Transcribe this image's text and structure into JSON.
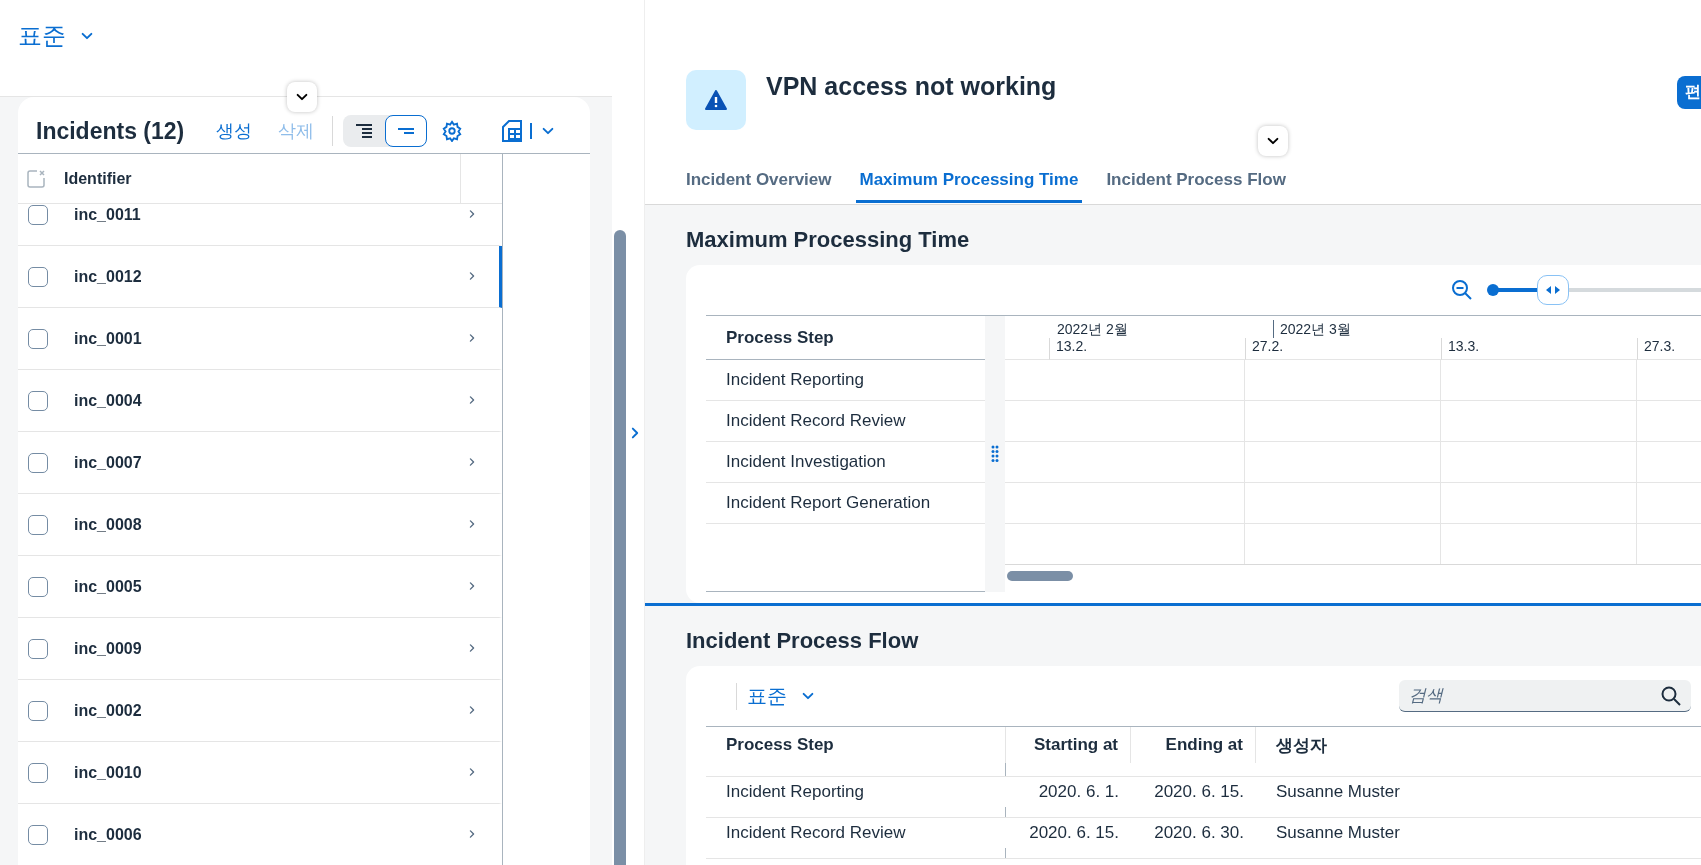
{
  "variant": {
    "label": "표준"
  },
  "list": {
    "title": "Incidents (12)",
    "actions": [
      {
        "label": "생성",
        "disabled": false
      },
      {
        "label": "삭제",
        "disabled": true
      }
    ],
    "view_toggle": [
      {
        "selected": false
      },
      {
        "selected": true
      }
    ],
    "column": "Identifier",
    "rows": [
      {
        "id": "inc_0011",
        "selected": false,
        "checked": false
      },
      {
        "id": "inc_0012",
        "selected": true,
        "checked": false
      },
      {
        "id": "inc_0001",
        "selected": false,
        "checked": false
      },
      {
        "id": "inc_0004",
        "selected": false,
        "checked": false
      },
      {
        "id": "inc_0007",
        "selected": false,
        "checked": false
      },
      {
        "id": "inc_0008",
        "selected": false,
        "checked": false
      },
      {
        "id": "inc_0005",
        "selected": false,
        "checked": false
      },
      {
        "id": "inc_0009",
        "selected": false,
        "checked": false
      },
      {
        "id": "inc_0002",
        "selected": false,
        "checked": false
      },
      {
        "id": "inc_0010",
        "selected": false,
        "checked": false
      },
      {
        "id": "inc_0006",
        "selected": false,
        "checked": false
      }
    ]
  },
  "object": {
    "title": "VPN access not working",
    "edit_button": "편",
    "tabs": [
      {
        "label": "Incident Overview",
        "selected": false
      },
      {
        "label": "Maximum Processing Time",
        "selected": true
      },
      {
        "label": "Incident Process Flow",
        "selected": false
      }
    ]
  },
  "gantt": {
    "title": "Maximum Processing Time",
    "zoom": {
      "level": 0.2
    },
    "step_column": "Process Step",
    "months": [
      "2022년 2월",
      "2022년 3월"
    ],
    "days": [
      "13.2.",
      "27.2.",
      "13.3.",
      "27.3."
    ],
    "steps": [
      "Incident Reporting",
      "Incident Record Review",
      "Incident Investigation",
      "Incident Report Generation"
    ]
  },
  "flow": {
    "title": "Incident Process Flow",
    "variant": "표준",
    "search": {
      "placeholder": "검색"
    },
    "columns": [
      {
        "label": "Process Step",
        "kind": "text"
      },
      {
        "label": "Starting at",
        "kind": "date"
      },
      {
        "label": "Ending at",
        "kind": "date"
      },
      {
        "label": "생성자",
        "kind": "text"
      }
    ],
    "rows": [
      [
        "Incident Reporting",
        "2020. 6. 1.",
        "2020. 6. 15.",
        "Susanne Muster"
      ],
      [
        "Incident Record Review",
        "2020. 6. 15.",
        "2020. 6. 30.",
        "Susanne Muster"
      ]
    ]
  }
}
